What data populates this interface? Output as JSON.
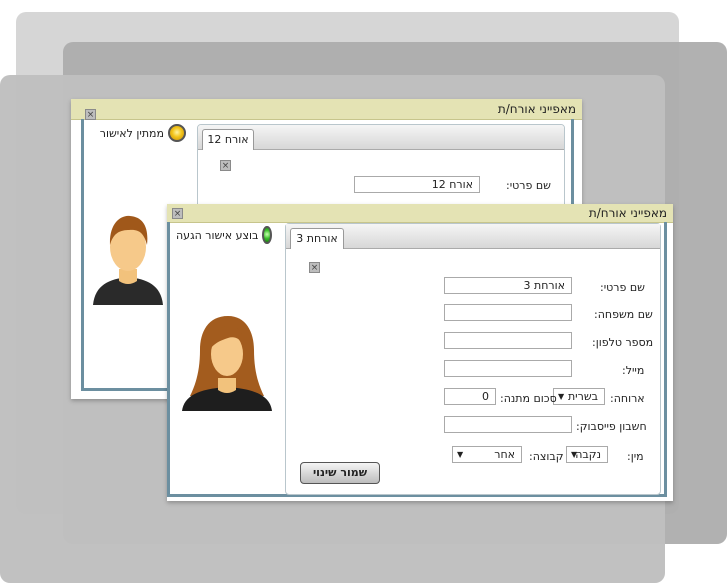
{
  "back_window": {
    "title": "מאפייני אורח/ת",
    "status_text": "ממתין לאישור",
    "status_color": "#f2c419",
    "tab_label": "אורח 12",
    "first_name_label": "שם פרטי:",
    "first_name_value": "אורח 12",
    "avatar_icon": "male-avatar-icon"
  },
  "front_window": {
    "title": "מאפייני אורח/ת",
    "status_text": "בוצע אישור הגעה",
    "status_color": "#3ac12b",
    "tab_label": "אורחת 3",
    "avatar_icon": "female-avatar-icon",
    "fields": {
      "first_name_label": "שם פרטי:",
      "first_name_value": "אורחת 3",
      "last_name_label": "שם משפחה:",
      "last_name_value": "",
      "phone_label": "מספר טלפון:",
      "phone_value": "",
      "email_label": "מייל:",
      "email_value": "",
      "meal_label": "ארוחה:",
      "meal_value": "בשרית",
      "gift_label": "סכום מתנה:",
      "gift_value": "0",
      "facebook_label": "חשבון פייסבוק:",
      "facebook_value": "",
      "gender_label": "מין:",
      "gender_value": "נקבה",
      "group_label": "קבוצה:",
      "group_value": "אחר"
    },
    "save_label": "שמור שינוי"
  }
}
